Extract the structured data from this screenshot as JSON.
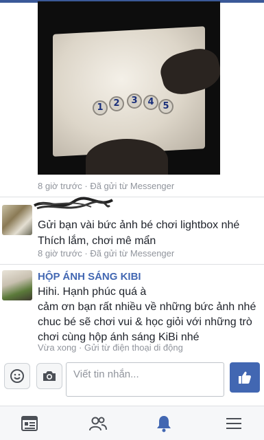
{
  "colors": {
    "brand": "#3b5998",
    "link": "#4267b2",
    "meta": "#90949c",
    "active_tab": "#4267b2"
  },
  "photo": {
    "icon": "photo-lightbox-bottle-caps",
    "caps": [
      "1",
      "2",
      "3",
      "4",
      "5"
    ]
  },
  "messages": [
    {
      "status": "8 giờ trước · Đã gửi từ Messenger"
    },
    {
      "avatar_icon": "avatar-photo",
      "lines": [
        "Gửi bạn vài bức ảnh bé chơi lightbox nhé",
        "Thích lắm, chơi mê mẩn"
      ],
      "status": "8 giờ trước · Đã gửi từ Messenger"
    },
    {
      "sender": "HỘP ÁNH SÁNG KIBI",
      "avatar_icon": "avatar-photo",
      "lines": [
        "Hihi. Hạnh phúc quá à",
        "cảm ơn bạn rất nhiều về những bức ảnh nhé",
        "chuc bé sẽ chơi vui & học giỏi với những trò chơi cùng hộp ánh sáng KiBi nhé"
      ],
      "status": "Vừa xong · Gửi từ điện thoại di động"
    }
  ],
  "composer": {
    "emoji_icon": "emoji-icon",
    "camera_icon": "camera-icon",
    "placeholder": "Viết tin nhắn...",
    "like_icon": "thumbs-up-icon"
  },
  "bottom_nav": [
    {
      "icon": "news-feed-icon",
      "active": false
    },
    {
      "icon": "friends-icon",
      "active": false
    },
    {
      "icon": "notifications-bell-icon",
      "active": true
    },
    {
      "icon": "menu-icon",
      "active": false
    }
  ]
}
